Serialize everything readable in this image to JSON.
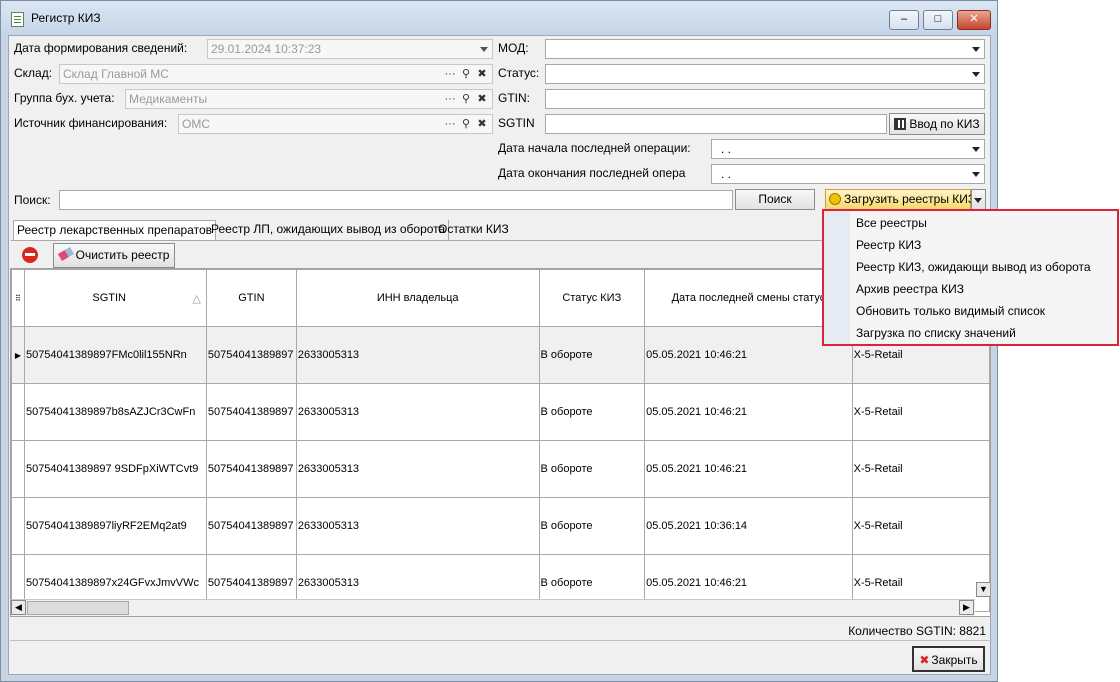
{
  "window": {
    "title": "Регистр КИЗ",
    "minimize": "–",
    "maximize": "□",
    "close": "✕"
  },
  "filters": {
    "date_label": "Дата формирования сведений:",
    "date_value": "29.01.2024 10:37:23",
    "warehouse_label": "Склад:",
    "warehouse_value": "Склад Главной МС",
    "acc_group_label": "Группа бух. учета:",
    "acc_group_value": "Медикаменты",
    "fin_source_label": "Источник финансирования:",
    "fin_source_value": "ОМС",
    "mod_label": "МОД:",
    "mod_value": "",
    "status_label": "Статус:",
    "status_value": "",
    "gtin_label": "GTIN:",
    "gtin_value": "",
    "sgtin_label": "SGTIN",
    "sgtin_value": "",
    "input_kiz_label": "Ввод по КИЗ",
    "op_start_label": "Дата начала последней операции:",
    "op_start_value": ". .",
    "op_end_label": "Дата окончания последней опера",
    "op_end_value": ". ."
  },
  "search": {
    "label": "Поиск:",
    "value": "",
    "button": "Поиск",
    "load_button": "Загрузить реестры КИЗ"
  },
  "tabs": [
    {
      "label": "Реестр лекарственных препаратов"
    },
    {
      "label": "Реестр ЛП, ожидающих вывод из оборота"
    },
    {
      "label": "Остатки КИЗ"
    }
  ],
  "toolbar": {
    "clear_label": "Очистить реестр"
  },
  "table": {
    "headers": [
      "SGTIN",
      "GTIN",
      "ИНН владельца",
      "Статус КИЗ",
      "Дата последней смены статус",
      ""
    ],
    "rows": [
      [
        "50754041389897FMc0lil155NRn",
        "50754041389897",
        "2633005313",
        "В обороте",
        "05.05.2021 10:46:21",
        "X-5-Retail"
      ],
      [
        "50754041389897b8sAZJCr3CwFn",
        "50754041389897",
        "2633005313",
        "В обороте",
        "05.05.2021 10:46:21",
        "X-5-Retail"
      ],
      [
        "50754041389897 9SDFpXiWTCvt9",
        "50754041389897",
        "2633005313",
        "В обороте",
        "05.05.2021 10:46:21",
        "X-5-Retail"
      ],
      [
        "50754041389897liyRF2EMq2at9",
        "50754041389897",
        "2633005313",
        "В обороте",
        "05.05.2021 10:36:14",
        "X-5-Retail"
      ],
      [
        "50754041389897x24GFvxJmvVWc",
        "50754041389897",
        "2633005313",
        "В обороте",
        "05.05.2021 10:46:21",
        "X-5-Retail"
      ]
    ]
  },
  "footer": {
    "count_text": "Количество SGTIN: 8821",
    "close_button": "Закрыть"
  },
  "dropdown_menu": [
    {
      "label": "Все реестры"
    },
    {
      "label": "Реестр КИЗ"
    },
    {
      "label": "Реестр КИЗ, ожидающи вывод из оборота"
    },
    {
      "label": "Архив реестра КИЗ"
    },
    {
      "label": "Обновить только видимый список"
    },
    {
      "label": "Загрузка по списку значений"
    }
  ],
  "colors": {
    "highlight_border": "#e0213a",
    "title_bar": "#c5d5e8"
  }
}
